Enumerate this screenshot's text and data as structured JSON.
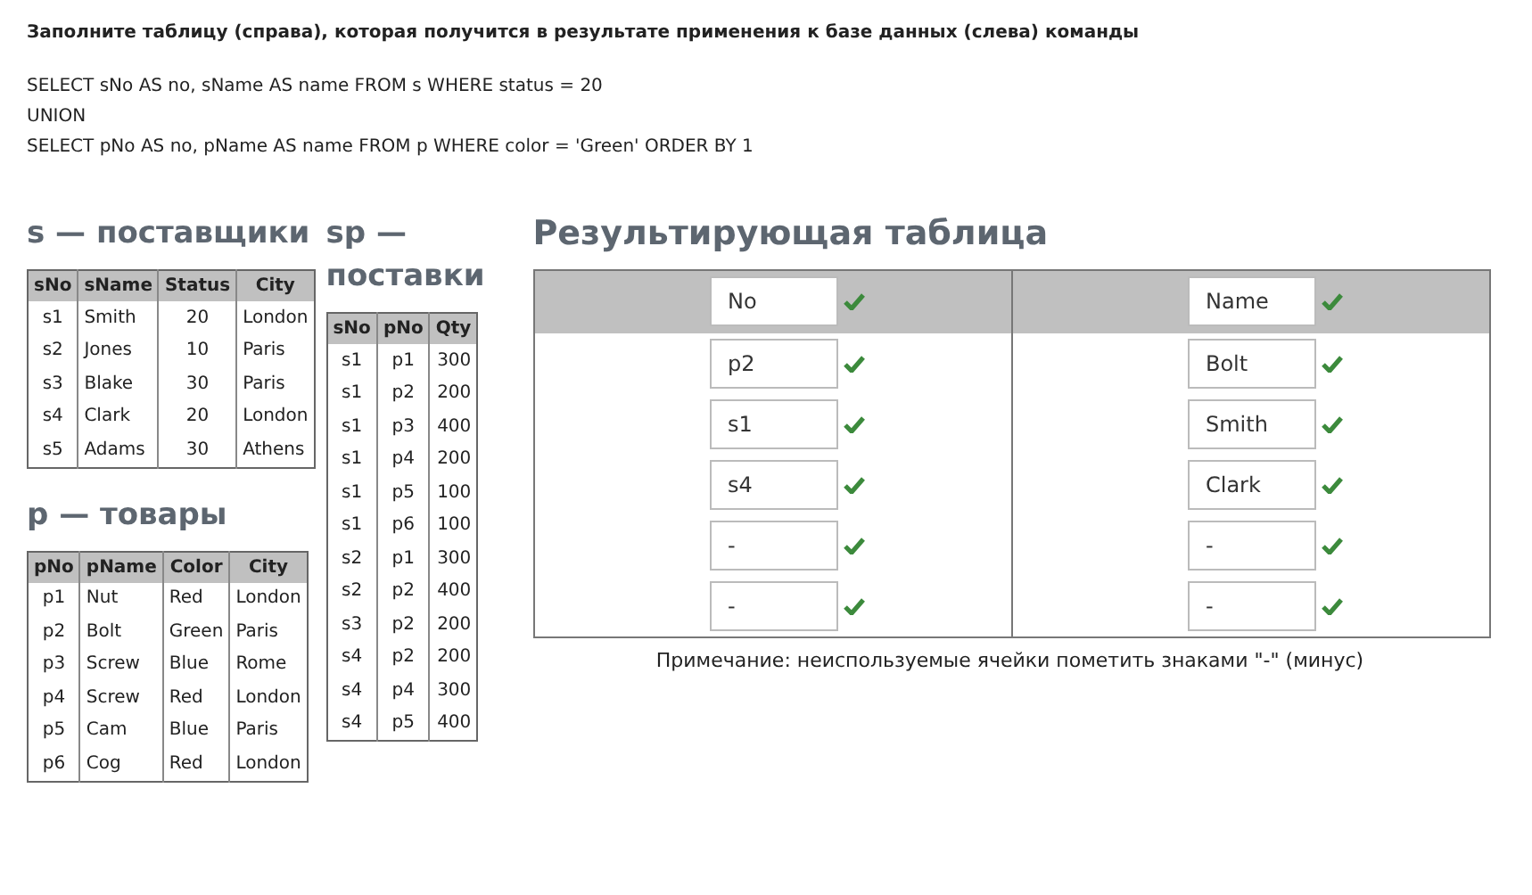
{
  "instruction": "Заполните таблицу (справа), которая получится в результате применения к базе данных (слева) команды",
  "query_lines": [
    "SELECT sNo AS no, sName AS name FROM s WHERE status = 20",
    "UNION",
    "SELECT pNo AS no, pName AS name FROM p WHERE color = 'Green' ORDER BY 1"
  ],
  "left_tables": [
    {
      "title": "s — поставщики",
      "columns": [
        "sNo",
        "sName",
        "Status",
        "City"
      ],
      "rows": [
        [
          "s1",
          "Smith",
          "20",
          "London"
        ],
        [
          "s2",
          "Jones",
          "10",
          "Paris"
        ],
        [
          "s3",
          "Blake",
          "30",
          "Paris"
        ],
        [
          "s4",
          "Clark",
          "20",
          "London"
        ],
        [
          "s5",
          "Adams",
          "30",
          "Athens"
        ]
      ]
    },
    {
      "title": "p — товары",
      "columns": [
        "pNo",
        "pName",
        "Color",
        "City"
      ],
      "rows": [
        [
          "p1",
          "Nut",
          "Red",
          "London"
        ],
        [
          "p2",
          "Bolt",
          "Green",
          "Paris"
        ],
        [
          "p3",
          "Screw",
          "Blue",
          "Rome"
        ],
        [
          "p4",
          "Screw",
          "Red",
          "London"
        ],
        [
          "p5",
          "Cam",
          "Blue",
          "Paris"
        ],
        [
          "p6",
          "Cog",
          "Red",
          "London"
        ]
      ]
    }
  ],
  "middle_tables": [
    {
      "title": "sp — поставки",
      "columns": [
        "sNo",
        "pNo",
        "Qty"
      ],
      "rows": [
        [
          "s1",
          "p1",
          "300"
        ],
        [
          "s1",
          "p2",
          "200"
        ],
        [
          "s1",
          "p3",
          "400"
        ],
        [
          "s1",
          "p4",
          "200"
        ],
        [
          "s1",
          "p5",
          "100"
        ],
        [
          "s1",
          "p6",
          "100"
        ],
        [
          "s2",
          "p1",
          "300"
        ],
        [
          "s2",
          "p2",
          "400"
        ],
        [
          "s3",
          "p2",
          "200"
        ],
        [
          "s4",
          "p2",
          "200"
        ],
        [
          "s4",
          "p4",
          "300"
        ],
        [
          "s4",
          "p5",
          "400"
        ]
      ]
    }
  ],
  "result": {
    "title": "Результирующая таблица",
    "header": [
      {
        "value": "No",
        "correct": true
      },
      {
        "value": "Name",
        "correct": true
      }
    ],
    "rows": [
      [
        {
          "value": "p2",
          "correct": true
        },
        {
          "value": "Bolt",
          "correct": true
        }
      ],
      [
        {
          "value": "s1",
          "correct": true
        },
        {
          "value": "Smith",
          "correct": true
        }
      ],
      [
        {
          "value": "s4",
          "correct": true
        },
        {
          "value": "Clark",
          "correct": true
        }
      ],
      [
        {
          "value": "-",
          "correct": true
        },
        {
          "value": "-",
          "correct": true
        }
      ],
      [
        {
          "value": "-",
          "correct": true
        },
        {
          "value": "-",
          "correct": true
        }
      ]
    ],
    "note": "Примечание: неиспользуемые ячейки пометить знаками \"-\" (минус)"
  }
}
